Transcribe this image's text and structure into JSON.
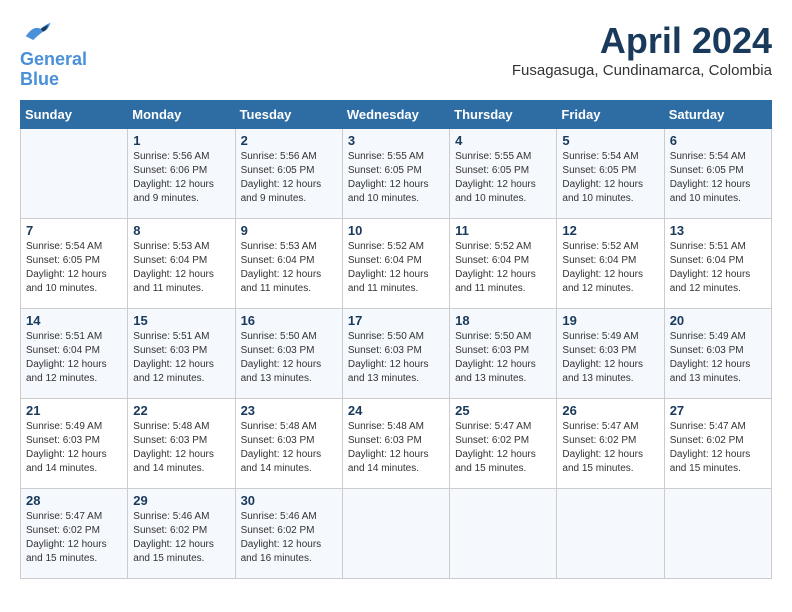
{
  "header": {
    "logo_line1": "General",
    "logo_line2": "Blue",
    "month": "April 2024",
    "location": "Fusagasuga, Cundinamarca, Colombia"
  },
  "days_of_week": [
    "Sunday",
    "Monday",
    "Tuesday",
    "Wednesday",
    "Thursday",
    "Friday",
    "Saturday"
  ],
  "weeks": [
    [
      {
        "day": "",
        "info": ""
      },
      {
        "day": "1",
        "info": "Sunrise: 5:56 AM\nSunset: 6:06 PM\nDaylight: 12 hours\nand 9 minutes."
      },
      {
        "day": "2",
        "info": "Sunrise: 5:56 AM\nSunset: 6:05 PM\nDaylight: 12 hours\nand 9 minutes."
      },
      {
        "day": "3",
        "info": "Sunrise: 5:55 AM\nSunset: 6:05 PM\nDaylight: 12 hours\nand 10 minutes."
      },
      {
        "day": "4",
        "info": "Sunrise: 5:55 AM\nSunset: 6:05 PM\nDaylight: 12 hours\nand 10 minutes."
      },
      {
        "day": "5",
        "info": "Sunrise: 5:54 AM\nSunset: 6:05 PM\nDaylight: 12 hours\nand 10 minutes."
      },
      {
        "day": "6",
        "info": "Sunrise: 5:54 AM\nSunset: 6:05 PM\nDaylight: 12 hours\nand 10 minutes."
      }
    ],
    [
      {
        "day": "7",
        "info": "Sunrise: 5:54 AM\nSunset: 6:05 PM\nDaylight: 12 hours\nand 10 minutes."
      },
      {
        "day": "8",
        "info": "Sunrise: 5:53 AM\nSunset: 6:04 PM\nDaylight: 12 hours\nand 11 minutes."
      },
      {
        "day": "9",
        "info": "Sunrise: 5:53 AM\nSunset: 6:04 PM\nDaylight: 12 hours\nand 11 minutes."
      },
      {
        "day": "10",
        "info": "Sunrise: 5:52 AM\nSunset: 6:04 PM\nDaylight: 12 hours\nand 11 minutes."
      },
      {
        "day": "11",
        "info": "Sunrise: 5:52 AM\nSunset: 6:04 PM\nDaylight: 12 hours\nand 11 minutes."
      },
      {
        "day": "12",
        "info": "Sunrise: 5:52 AM\nSunset: 6:04 PM\nDaylight: 12 hours\nand 12 minutes."
      },
      {
        "day": "13",
        "info": "Sunrise: 5:51 AM\nSunset: 6:04 PM\nDaylight: 12 hours\nand 12 minutes."
      }
    ],
    [
      {
        "day": "14",
        "info": "Sunrise: 5:51 AM\nSunset: 6:04 PM\nDaylight: 12 hours\nand 12 minutes."
      },
      {
        "day": "15",
        "info": "Sunrise: 5:51 AM\nSunset: 6:03 PM\nDaylight: 12 hours\nand 12 minutes."
      },
      {
        "day": "16",
        "info": "Sunrise: 5:50 AM\nSunset: 6:03 PM\nDaylight: 12 hours\nand 13 minutes."
      },
      {
        "day": "17",
        "info": "Sunrise: 5:50 AM\nSunset: 6:03 PM\nDaylight: 12 hours\nand 13 minutes."
      },
      {
        "day": "18",
        "info": "Sunrise: 5:50 AM\nSunset: 6:03 PM\nDaylight: 12 hours\nand 13 minutes."
      },
      {
        "day": "19",
        "info": "Sunrise: 5:49 AM\nSunset: 6:03 PM\nDaylight: 12 hours\nand 13 minutes."
      },
      {
        "day": "20",
        "info": "Sunrise: 5:49 AM\nSunset: 6:03 PM\nDaylight: 12 hours\nand 13 minutes."
      }
    ],
    [
      {
        "day": "21",
        "info": "Sunrise: 5:49 AM\nSunset: 6:03 PM\nDaylight: 12 hours\nand 14 minutes."
      },
      {
        "day": "22",
        "info": "Sunrise: 5:48 AM\nSunset: 6:03 PM\nDaylight: 12 hours\nand 14 minutes."
      },
      {
        "day": "23",
        "info": "Sunrise: 5:48 AM\nSunset: 6:03 PM\nDaylight: 12 hours\nand 14 minutes."
      },
      {
        "day": "24",
        "info": "Sunrise: 5:48 AM\nSunset: 6:03 PM\nDaylight: 12 hours\nand 14 minutes."
      },
      {
        "day": "25",
        "info": "Sunrise: 5:47 AM\nSunset: 6:02 PM\nDaylight: 12 hours\nand 15 minutes."
      },
      {
        "day": "26",
        "info": "Sunrise: 5:47 AM\nSunset: 6:02 PM\nDaylight: 12 hours\nand 15 minutes."
      },
      {
        "day": "27",
        "info": "Sunrise: 5:47 AM\nSunset: 6:02 PM\nDaylight: 12 hours\nand 15 minutes."
      }
    ],
    [
      {
        "day": "28",
        "info": "Sunrise: 5:47 AM\nSunset: 6:02 PM\nDaylight: 12 hours\nand 15 minutes."
      },
      {
        "day": "29",
        "info": "Sunrise: 5:46 AM\nSunset: 6:02 PM\nDaylight: 12 hours\nand 15 minutes."
      },
      {
        "day": "30",
        "info": "Sunrise: 5:46 AM\nSunset: 6:02 PM\nDaylight: 12 hours\nand 16 minutes."
      },
      {
        "day": "",
        "info": ""
      },
      {
        "day": "",
        "info": ""
      },
      {
        "day": "",
        "info": ""
      },
      {
        "day": "",
        "info": ""
      }
    ]
  ]
}
